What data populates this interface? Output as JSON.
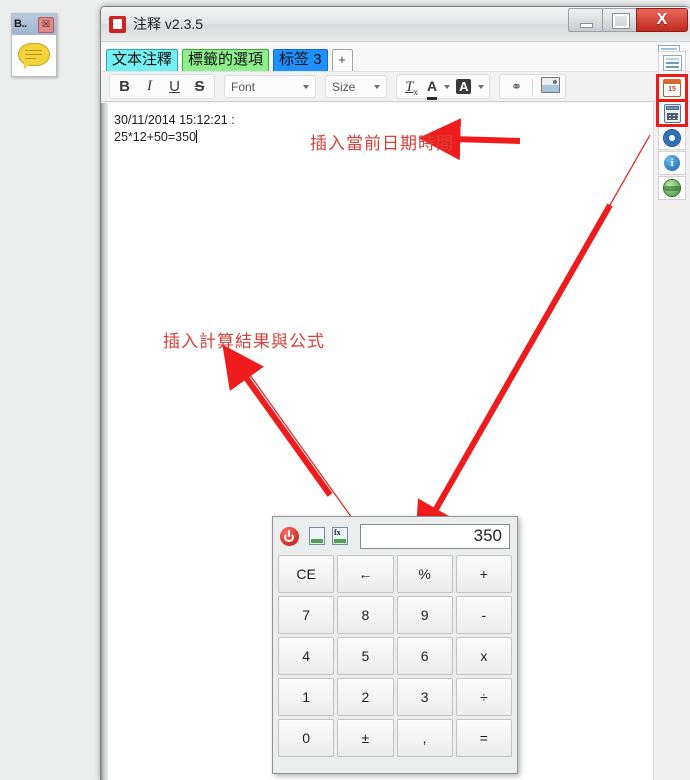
{
  "gadget": {
    "title": "B..",
    "close_label": "☒",
    "icon": "speech-bubble-icon"
  },
  "window": {
    "title": "注释 v2.3.5",
    "app_icon": "notes-app-icon",
    "controls": {
      "minimize": "minimize-icon",
      "maximize": "maximize-icon",
      "close": "X"
    }
  },
  "tabs": {
    "items": [
      {
        "label": "文本注釋",
        "bg": "#74f0f2",
        "border": "#2aa9ab"
      },
      {
        "label": "標籤的選項",
        "bg": "#8df08d",
        "border": "#3aa93a"
      },
      {
        "label": "标签 3",
        "bg": "#1e90ff",
        "border": "#0d6ec9"
      }
    ],
    "add_label": "+",
    "right_icon": "list-view-icon"
  },
  "toolbar": {
    "bold": "B",
    "italic": "I",
    "underline": "U",
    "strike": "S",
    "font_label": "Font",
    "size_label": "Size",
    "clear_format": "T",
    "clear_format_sub": "x",
    "text_color": "A",
    "highlight": "A",
    "link_icon": "link-icon",
    "image_icon": "image-icon"
  },
  "editor": {
    "line1": "30/11/2014 15:12:21 :",
    "line2": "25*12+50=350"
  },
  "icon_strip": {
    "items": [
      {
        "name": "list-view-icon",
        "label": "",
        "highlighted": false
      },
      {
        "name": "calendar-icon",
        "label": "15",
        "highlighted": true
      },
      {
        "name": "calculator-icon",
        "label": "",
        "highlighted": true
      },
      {
        "name": "settings-gear-icon",
        "label": "",
        "highlighted": false
      },
      {
        "name": "info-icon",
        "label": "i",
        "highlighted": false
      },
      {
        "name": "globe-icon",
        "label": "",
        "highlighted": false
      }
    ]
  },
  "annotations": {
    "date_time": "插入當前日期時間",
    "calc_result": "插入計算結果與公式",
    "color": "#d8403a"
  },
  "calculator": {
    "power_icon": "power-button-icon",
    "insert_result_icon": "insert-result-icon",
    "insert_formula_icon": "insert-formula-icon",
    "display_value": "350",
    "keys": [
      "CE",
      "←",
      "%",
      "+",
      "7",
      "8",
      "9",
      "-",
      "4",
      "5",
      "6",
      "x",
      "1",
      "2",
      "3",
      "÷",
      "0",
      "±",
      ",",
      "="
    ]
  }
}
